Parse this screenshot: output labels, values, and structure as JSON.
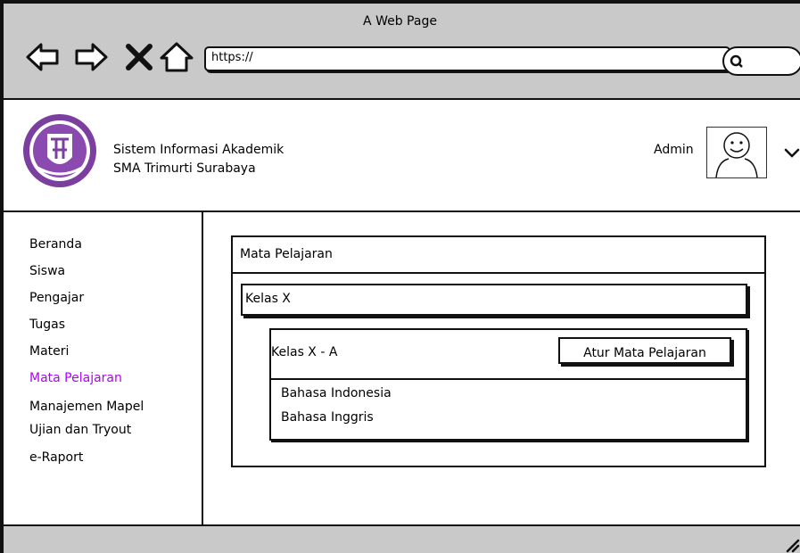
{
  "browser": {
    "window_title": "A Web Page",
    "url": "https://"
  },
  "header": {
    "app_name_line1": "Sistem Informasi Akademik",
    "app_name_line2": "SMA Trimurti Surabaya",
    "user_name": "Admin"
  },
  "sidebar": {
    "items": [
      {
        "label": "Beranda"
      },
      {
        "label": "Siswa"
      },
      {
        "label": "Pengajar"
      },
      {
        "label": "Tugas"
      },
      {
        "label": "Materi"
      },
      {
        "label": "Mata Pelajaran"
      },
      {
        "label": "Manajemen Mapel"
      },
      {
        "label": "Ujian dan Tryout"
      },
      {
        "label": "e-Raport"
      }
    ],
    "active_index": 5,
    "active_color": "#b000ff"
  },
  "main": {
    "panel_title": "Mata Pelajaran",
    "group_label": "Kelas X",
    "class_card": {
      "name": "Kelas X - A",
      "button_label": "Atur Mata Pelajaran",
      "subjects": [
        "Bahasa Indonesia",
        "Bahasa Inggris"
      ]
    }
  },
  "icons": {
    "back": "back-arrow-icon",
    "forward": "forward-arrow-icon",
    "stop": "close-icon",
    "home": "home-icon",
    "search": "search-icon",
    "avatar": "user-avatar-icon",
    "dropdown": "chevron-down-icon",
    "logo": "school-logo"
  }
}
